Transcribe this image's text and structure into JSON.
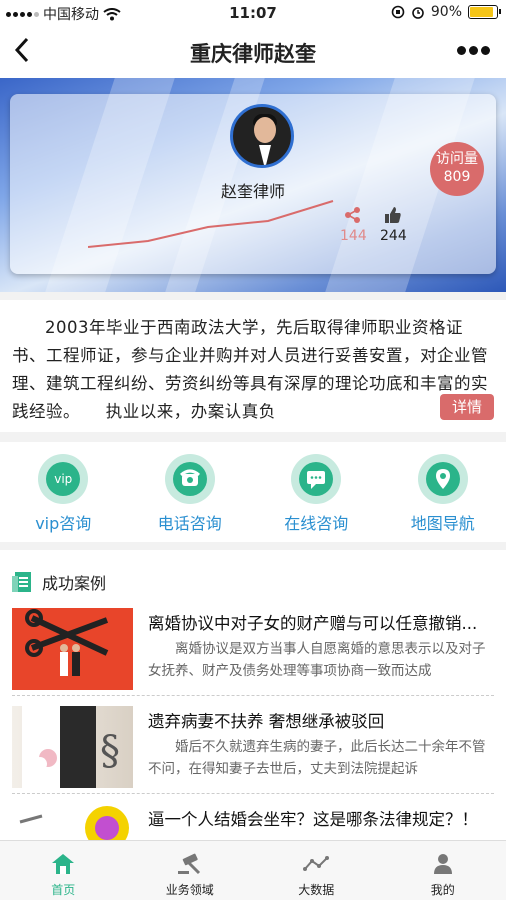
{
  "status_bar": {
    "carrier": "中国移动",
    "time": "11:07",
    "battery": "90%",
    "battery_level": 0.9
  },
  "nav": {
    "title": "重庆律师赵奎",
    "back_icon": "chevron-left-icon",
    "more_icon": "more-dots-icon"
  },
  "profile": {
    "name": "赵奎律师",
    "visits_label": "访问量",
    "visits": "809",
    "shares": "144",
    "likes": "244"
  },
  "intro": {
    "text": "2003年毕业于西南政法大学，先后取得律师职业资格证书、工程师证，参与企业并购并对人员进行妥善安置，对企业管理、建筑工程纠纷、劳资纠纷等具有深厚的理论功底和丰富的实践经验。　　执业以来，办案认真负",
    "detail_label": "详情"
  },
  "services": [
    {
      "label": "vip咨询",
      "icon": "vip-icon"
    },
    {
      "label": "电话咨询",
      "icon": "phone-icon"
    },
    {
      "label": "在线咨询",
      "icon": "chat-icon"
    },
    {
      "label": "地图导航",
      "icon": "map-pin-icon"
    }
  ],
  "cases": {
    "heading": "成功案例",
    "items": [
      {
        "title": "离婚协议中对子女的财产赠与可以任意撤销...",
        "desc": "离婚协议是双方当事人自愿离婚的意思表示以及对子女抚养、财产及债务处理等事项协商一致而达成"
      },
      {
        "title": "遗弃病妻不扶养 奢想继承被驳回",
        "desc": "婚后不久就遗弃生病的妻子，此后长达二十余年不管不问，在得知妻子去世后，丈夫到法院提起诉"
      },
      {
        "title": "逼一个人结婚会坐牢？这是哪条法律规定？！",
        "desc": ""
      }
    ]
  },
  "tabbar": [
    {
      "label": "首页",
      "icon": "home-icon"
    },
    {
      "label": "业务领域",
      "icon": "gavel-icon"
    },
    {
      "label": "大数据",
      "icon": "graph-icon"
    },
    {
      "label": "我的",
      "icon": "user-icon"
    }
  ],
  "colors": {
    "accent": "#2bb48a",
    "badge": "#d96b6b",
    "link": "#2a8fd0"
  }
}
